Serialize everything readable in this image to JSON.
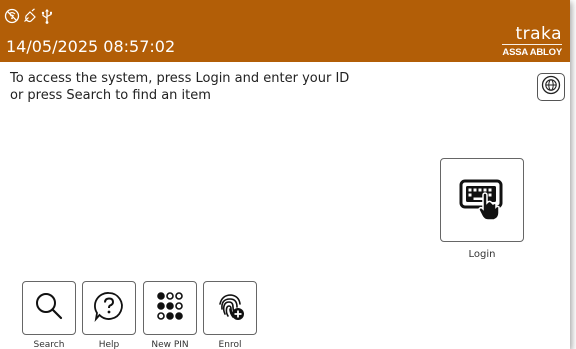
{
  "header": {
    "datetime": "14/05/2025 08:57:02",
    "brand_name": "traka",
    "brand_subtitle": "ASSA ABLOY",
    "background_color": "#b25e07",
    "status_icons": [
      "no-connection-icon",
      "power-off-icon",
      "usb-icon"
    ]
  },
  "main": {
    "instruction_line1": "To access the system, press Login and enter your ID",
    "instruction_line2": "or press Search to find an item",
    "language_button_icon": "globe-icon",
    "login": {
      "label": "Login",
      "icon": "keyboard-hand-icon"
    }
  },
  "toolbar": {
    "search_label": "Search",
    "help_label": "Help",
    "new_pin_label": "New PIN",
    "enrol_label": "Enrol"
  }
}
